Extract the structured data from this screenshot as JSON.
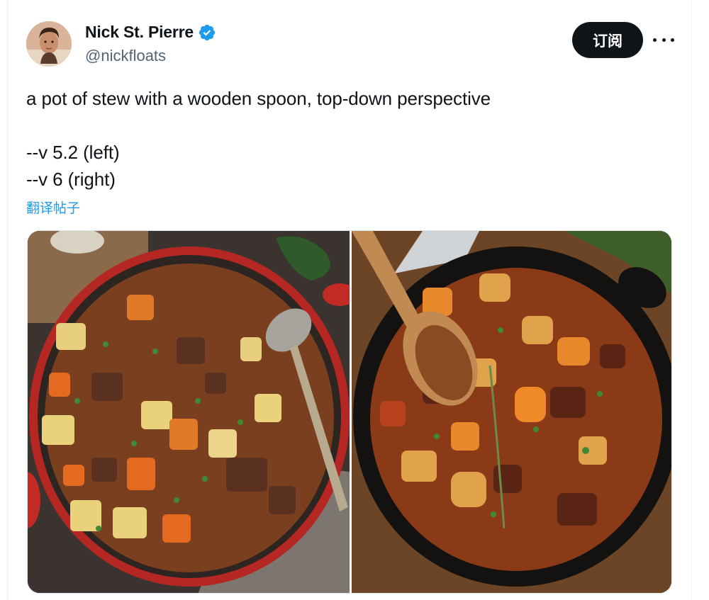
{
  "post": {
    "author": {
      "name": "Nick St. Pierre",
      "handle": "@nickfloats",
      "verified": true
    },
    "subscribe_label": "订阅",
    "text": "a pot of stew with a wooden spoon, top-down perspective\n\n--v 5.2 (left)\n--v 6 (right)",
    "translate_label": "翻译帖子"
  },
  "icons": {
    "verified": "verified-badge-icon",
    "more": "more-horizontal-icon"
  },
  "colors": {
    "accent": "#1d9bf0",
    "text": "#0f1419",
    "secondary_text": "#536471",
    "button_bg": "#0f1419"
  }
}
